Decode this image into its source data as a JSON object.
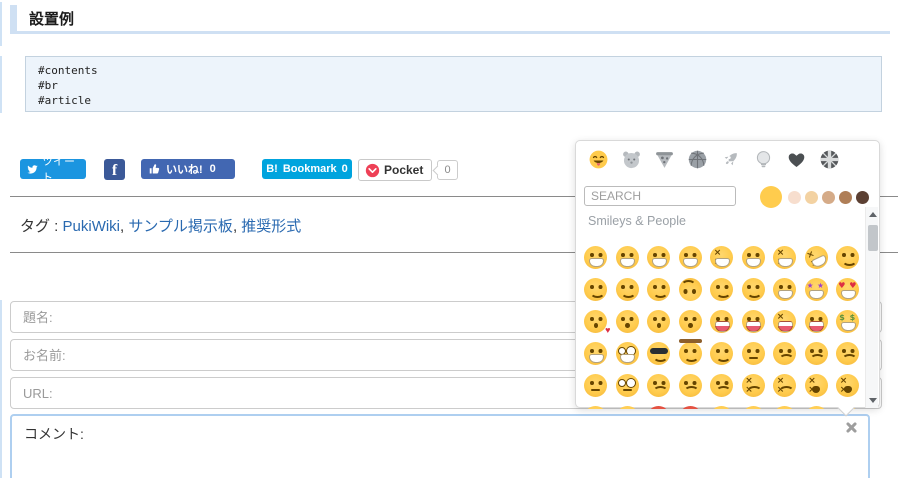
{
  "page": {
    "heading": "設置例",
    "code_block": {
      "lines": [
        "#contents",
        "#br",
        "#article"
      ]
    },
    "share_bar": {
      "tweet_label": "ツイート",
      "facebook_f": "f",
      "like_label": "いいね!",
      "like_count": "0",
      "hatena_b": "B!",
      "hatena_label": "Bookmark",
      "hatena_count": "0",
      "pocket_label": "Pocket",
      "pocket_count": "0"
    },
    "tags": {
      "label": "タグ :",
      "separator": ", ",
      "items": [
        "PukiWiki",
        "サンプル掲示板",
        "推奨形式"
      ]
    },
    "form": {
      "subject_placeholder": "題名:",
      "name_placeholder": "お名前:",
      "url_placeholder": "URL:",
      "comment_text": "コメント:"
    }
  },
  "emoji_picker": {
    "search_placeholder": "SEARCH",
    "section_title": "Smileys & People",
    "categories": [
      {
        "icon": "smiley-icon",
        "name": "smileys-people",
        "active": true
      },
      {
        "icon": "hamster-icon",
        "name": "animals-nature",
        "active": false
      },
      {
        "icon": "pizza-icon",
        "name": "food-drink",
        "active": false
      },
      {
        "icon": "basketball-icon",
        "name": "activity",
        "active": false
      },
      {
        "icon": "rocket-icon",
        "name": "travel-places",
        "active": false
      },
      {
        "icon": "bulb-icon",
        "name": "objects",
        "active": false
      },
      {
        "icon": "heart-icon",
        "name": "symbols",
        "active": false
      },
      {
        "icon": "flag-icon",
        "name": "flags",
        "active": false
      }
    ],
    "skin_tones": [
      {
        "color": "#FFCC4D",
        "selected": true
      },
      {
        "color": "#F7DECE",
        "selected": false
      },
      {
        "color": "#F3D2A2",
        "selected": false
      },
      {
        "color": "#D5AB88",
        "selected": false
      },
      {
        "color": "#AF7E57",
        "selected": false
      },
      {
        "color": "#5C4033",
        "selected": false
      }
    ],
    "emoji_rows": [
      [
        {
          "ch": "😀",
          "name": "grinning-face",
          "v": "m-g"
        },
        {
          "ch": "😃",
          "name": "grinning-face-big-eyes",
          "v": "m-g"
        },
        {
          "ch": "😄",
          "name": "grinning-face-smiling-eyes",
          "v": "m-g"
        },
        {
          "ch": "😁",
          "name": "beaming-face",
          "v": "m-g"
        },
        {
          "ch": "😆",
          "name": "grinning-squinting-face",
          "v": "e-x m-g"
        },
        {
          "ch": "😅",
          "name": "grinning-face-with-sweat",
          "v": "m-g"
        },
        {
          "ch": "😂",
          "name": "face-with-tears-of-joy",
          "v": "e-x m-g"
        },
        {
          "ch": "🤣",
          "name": "rolling-on-the-floor-laughing",
          "v": "e-x m-g tilt"
        },
        {
          "ch": "☺️",
          "name": "smiling-face",
          "v": "m-s"
        }
      ],
      [
        {
          "ch": "😊",
          "name": "smiling-face-with-smiling-eyes",
          "v": "m-s"
        },
        {
          "ch": "😇",
          "name": "smiling-face-with-halo",
          "v": "m-s"
        },
        {
          "ch": "🙂",
          "name": "slightly-smiling-face",
          "v": "m-s"
        },
        {
          "ch": "🙃",
          "name": "upside-down-face",
          "v": "m-s flip"
        },
        {
          "ch": "😉",
          "name": "winking-face",
          "v": "m-s"
        },
        {
          "ch": "😌",
          "name": "relieved-face",
          "v": "m-s"
        },
        {
          "ch": "🤪",
          "name": "zany-face",
          "v": "m-g"
        },
        {
          "ch": "🤩",
          "name": "star-struck",
          "v": "e-st m-g"
        },
        {
          "ch": "😍",
          "name": "smiling-face-with-heart-eyes",
          "v": "e-h m-g"
        }
      ],
      [
        {
          "ch": "😘",
          "name": "face-blowing-a-kiss",
          "v": "m-k x-heart"
        },
        {
          "ch": "😗",
          "name": "kissing-face",
          "v": "m-k"
        },
        {
          "ch": "😙",
          "name": "kissing-face-with-smiling-eyes",
          "v": "m-k"
        },
        {
          "ch": "😚",
          "name": "kissing-face-with-closed-eyes",
          "v": "m-k"
        },
        {
          "ch": "😋",
          "name": "face-savoring-food",
          "v": "m-t"
        },
        {
          "ch": "😜",
          "name": "winking-face-with-tongue",
          "v": "m-t"
        },
        {
          "ch": "😝",
          "name": "squinting-face-with-tongue",
          "v": "e-x m-t"
        },
        {
          "ch": "😛",
          "name": "face-with-tongue",
          "v": "m-t"
        },
        {
          "ch": "🤑",
          "name": "money-mouth-face",
          "v": "e-money m-g"
        }
      ],
      [
        {
          "ch": "🤗",
          "name": "hugging-face",
          "v": "m-g"
        },
        {
          "ch": "🤓",
          "name": "nerd-face",
          "v": "e-gl m-g"
        },
        {
          "ch": "😎",
          "name": "smiling-face-with-sunglasses",
          "v": "e-sh m-s"
        },
        {
          "ch": "🤠",
          "name": "cowboy-hat-face",
          "v": "m-s x-hat"
        },
        {
          "ch": "😏",
          "name": "smirking-face",
          "v": "m-s"
        },
        {
          "ch": "😒",
          "name": "unamused-face",
          "v": "m-l"
        },
        {
          "ch": "😞",
          "name": "disappointed-face",
          "v": "m-f"
        },
        {
          "ch": "😔",
          "name": "pensive-face",
          "v": "m-f"
        },
        {
          "ch": "😟",
          "name": "worried-face",
          "v": "m-f"
        }
      ],
      [
        {
          "ch": "🤨",
          "name": "face-with-raised-eyebrow",
          "v": "m-l"
        },
        {
          "ch": "🧐",
          "name": "face-with-monocle",
          "v": "e-gl m-l"
        },
        {
          "ch": "😕",
          "name": "confused-face",
          "v": "m-f"
        },
        {
          "ch": "🙁",
          "name": "slightly-frowning-face",
          "v": "m-f"
        },
        {
          "ch": "☹️",
          "name": "frowning-face",
          "v": "m-f"
        },
        {
          "ch": "😖",
          "name": "confounded-face",
          "v": "e-x m-f"
        },
        {
          "ch": "😣",
          "name": "persevering-face",
          "v": "e-x m-f"
        },
        {
          "ch": "😫",
          "name": "tired-face",
          "v": "e-x m-o"
        },
        {
          "ch": "😩",
          "name": "weary-face",
          "v": "e-x m-o"
        }
      ],
      [
        {
          "ch": "😤",
          "name": "face-with-steam-from-nose",
          "v": "e-x m-f"
        },
        {
          "ch": "😠",
          "name": "angry-face",
          "v": "m-f"
        },
        {
          "ch": "😡",
          "name": "pouting-face",
          "v": "m-f c-r"
        },
        {
          "ch": "🤬",
          "name": "face-with-symbols-on-mouth",
          "v": "m-l c-r"
        },
        {
          "ch": "😶",
          "name": "face-without-mouth",
          "v": "m-n"
        },
        {
          "ch": "😐",
          "name": "neutral-face",
          "v": "m-l"
        },
        {
          "ch": "😑",
          "name": "expressionless-face",
          "v": "m-l"
        },
        {
          "ch": "🙄",
          "name": "face-with-rolling-eyes",
          "v": "m-l"
        },
        {
          "ch": "😯",
          "name": "hushed-face",
          "v": "m-k"
        }
      ]
    ]
  },
  "colors": {
    "tweet_blue": "#1b95e0",
    "facebook_blue": "#3b5998",
    "like_blue": "#4267b2",
    "hatena_cyan": "#00a4de",
    "pocket_red": "#ee4056",
    "link_blue": "#2969b0",
    "heading_accent": "#cfe0f3",
    "code_bg": "#edf4fb",
    "divider_gray": "#8a8a8a",
    "textarea_focus_border": "#aecff0",
    "emoji_yellow": "#ffcb4c"
  }
}
